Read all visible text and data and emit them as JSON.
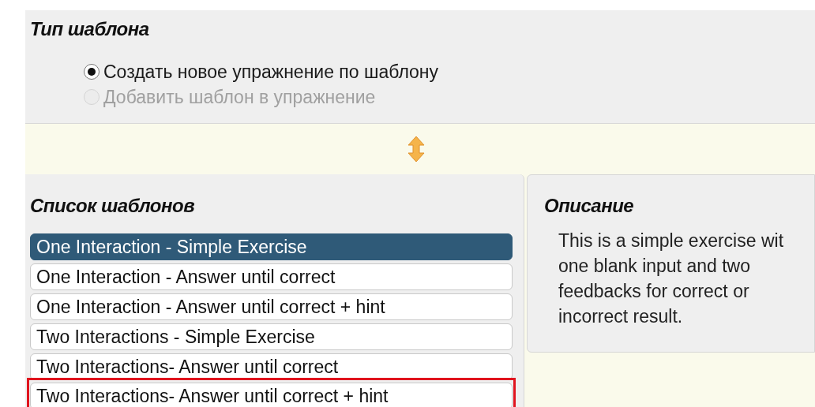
{
  "template_type": {
    "title": "Тип шаблона",
    "options": [
      {
        "label": "Создать новое упражнение по шаблону",
        "selected": true,
        "disabled": false
      },
      {
        "label": "Добавить шаблон в упражнение",
        "selected": false,
        "disabled": true
      }
    ]
  },
  "template_list": {
    "title": "Список шаблонов",
    "items": [
      {
        "label": "One Interaction - Simple Exercise",
        "selected": true,
        "highlighted": false
      },
      {
        "label": "One Interaction - Answer until correct",
        "selected": false,
        "highlighted": false
      },
      {
        "label": "One Interaction - Answer until correct + hint",
        "selected": false,
        "highlighted": false
      },
      {
        "label": "Two Interactions - Simple Exercise",
        "selected": false,
        "highlighted": false
      },
      {
        "label": "Two Interactions- Answer until correct",
        "selected": false,
        "highlighted": false
      },
      {
        "label": "Two Interactions- Answer until correct + hint",
        "selected": false,
        "highlighted": true
      }
    ]
  },
  "description": {
    "title": "Описание",
    "text": "This is a simple exercise wit\none blank input and two\nfeedbacks for correct or\nincorrect result."
  }
}
